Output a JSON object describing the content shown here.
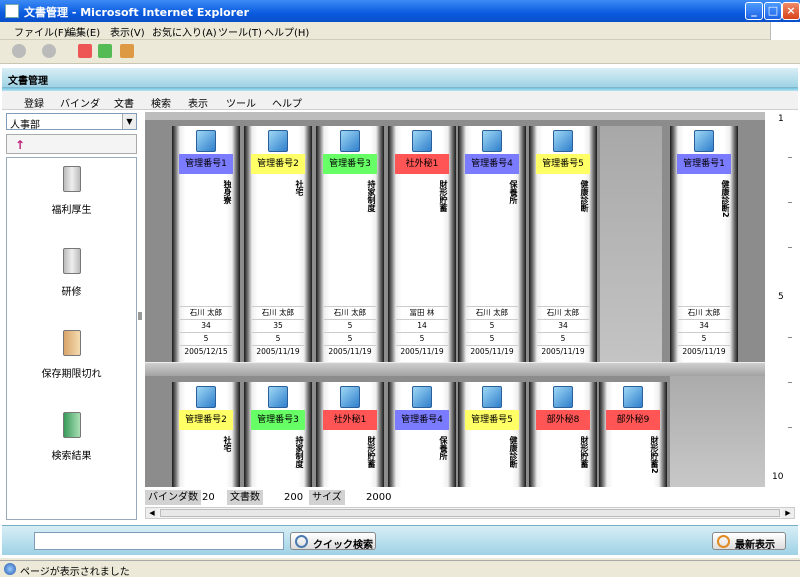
{
  "window": {
    "title": "文書管理 - Microsoft Internet Explorer"
  },
  "ie_menu": [
    "ファイル(F)",
    "編集(E)",
    "表示(V)",
    "お気に入り(A)",
    "ツール(T)",
    "ヘルプ(H)"
  ],
  "app": {
    "title": "文書管理",
    "menu": [
      "登録",
      "バインダ",
      "文書",
      "検索",
      "表示",
      "ツール",
      "ヘルプ"
    ],
    "department": "人事部",
    "up_arrow": "↑"
  },
  "folders": [
    {
      "label": "福利厚生",
      "icon": "binder-icon"
    },
    {
      "label": "研修",
      "icon": "binder-icon"
    },
    {
      "label": "保存期限切れ",
      "icon": "expired-icon"
    },
    {
      "label": "検索結果",
      "icon": "search-result-icon"
    }
  ],
  "shelf_top": [
    {
      "label": "管理番号1",
      "color": "#7b7bff",
      "title": "独身寮",
      "owner": "石川 太郎",
      "n1": "34",
      "n2": "5",
      "date": "2005/12/15"
    },
    {
      "label": "管理番号2",
      "color": "#ffff66",
      "title": "社宅",
      "owner": "石川 太郎",
      "n1": "35",
      "n2": "5",
      "date": "2005/11/19"
    },
    {
      "label": "管理番号3",
      "color": "#66ff66",
      "title": "持家制度",
      "owner": "石川 太郎",
      "n1": "5",
      "n2": "5",
      "date": "2005/11/19"
    },
    {
      "label": "社外秘1",
      "color": "#ff5555",
      "title": "財形貯蓄",
      "owner": "冨田 林",
      "n1": "14",
      "n2": "5",
      "date": "2005/11/19"
    },
    {
      "label": "管理番号4",
      "color": "#7b7bff",
      "title": "保養所",
      "owner": "石川 太郎",
      "n1": "5",
      "n2": "5",
      "date": "2005/11/19"
    },
    {
      "label": "管理番号5",
      "color": "#ffff66",
      "title": "健康診断",
      "owner": "石川 太郎",
      "n1": "34",
      "n2": "5",
      "date": "2005/11/19"
    },
    {
      "label": "管理番号1",
      "color": "#7b7bff",
      "title": "健康診断2",
      "owner": "石川 太郎",
      "n1": "34",
      "n2": "5",
      "date": "2005/11/19"
    }
  ],
  "shelf_bottom": [
    {
      "label": "管理番号2",
      "color": "#ffff66",
      "title": "社宅"
    },
    {
      "label": "管理番号3",
      "color": "#66ff66",
      "title": "持家制度"
    },
    {
      "label": "社外秘1",
      "color": "#ff5555",
      "title": "財形貯蓄"
    },
    {
      "label": "管理番号4",
      "color": "#7b7bff",
      "title": "保養所"
    },
    {
      "label": "管理番号5",
      "color": "#ffff66",
      "title": "健康診断"
    },
    {
      "label": "部外秘8",
      "color": "#ff5555",
      "title": "財形貯蓄"
    },
    {
      "label": "部外秘9",
      "color": "#ff5555",
      "title": "財形貯蓄2"
    }
  ],
  "stats": {
    "binder_label": "バインダ数",
    "binder_value": "20",
    "doc_label": "文書数",
    "doc_value": "200",
    "size_label": "サイズ",
    "size_value": "2000"
  },
  "ruler": {
    "top": "1",
    "mid": "5",
    "bottom": "10"
  },
  "bottom": {
    "quick_search": "クイック検索",
    "refresh": "最新表示",
    "search_value": ""
  },
  "status_text": "ページが表示されました"
}
